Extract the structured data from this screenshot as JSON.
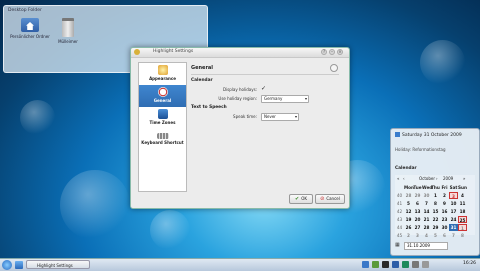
{
  "folder_view": {
    "title": "Desktop Folder",
    "items": [
      {
        "label": "Persönlicher Ordner",
        "icon": "home-folder-icon"
      },
      {
        "label": "Mülleimer",
        "icon": "trash-icon"
      }
    ]
  },
  "window": {
    "title": "Highlight Settings",
    "sidebar": [
      {
        "label": "Appearance",
        "icon": "appearance-icon",
        "active": false
      },
      {
        "label": "General",
        "icon": "clock-icon",
        "active": true
      },
      {
        "label": "Time Zones",
        "icon": "time-zones-icon",
        "active": false
      },
      {
        "label": "Keyboard Shortcut",
        "icon": "keyboard-icon",
        "active": false
      }
    ],
    "page_title": "General",
    "calendar_section": "Calendar",
    "display_holidays_label": "Display holidays:",
    "display_holidays_checked": "✓",
    "use_holiday_region_label": "Use holiday region:",
    "use_holiday_region_value": "Germany",
    "tts_section": "Text to Speech",
    "speak_time_label": "Speak time:",
    "speak_time_value": "Never",
    "ok_label": "OK",
    "cancel_label": "Cancel"
  },
  "calendar": {
    "header": "Saturday 31 October 2009",
    "holiday_text": "Holiday: Reformationstag",
    "section": "Calendar",
    "month": "October",
    "year": "2009",
    "weekdays": [
      "Mon",
      "Tue",
      "Wed",
      "Thu",
      "Fri",
      "Sat",
      "Sun"
    ],
    "weeks": [
      {
        "wk": "40",
        "days": [
          "28",
          "29",
          "30",
          "1",
          "2",
          "3",
          "4"
        ]
      },
      {
        "wk": "41",
        "days": [
          "5",
          "6",
          "7",
          "8",
          "9",
          "10",
          "11"
        ]
      },
      {
        "wk": "42",
        "days": [
          "12",
          "13",
          "14",
          "15",
          "16",
          "17",
          "18"
        ]
      },
      {
        "wk": "43",
        "days": [
          "19",
          "20",
          "21",
          "22",
          "23",
          "24",
          "25"
        ]
      },
      {
        "wk": "44",
        "days": [
          "26",
          "27",
          "28",
          "29",
          "30",
          "31",
          "1"
        ]
      },
      {
        "wk": "45",
        "days": [
          "2",
          "3",
          "4",
          "5",
          "6",
          "7",
          "8"
        ]
      }
    ],
    "date_field": "31.10.2009"
  },
  "taskbar": {
    "task_label": "Highlight Settings",
    "clock": "16:26"
  }
}
